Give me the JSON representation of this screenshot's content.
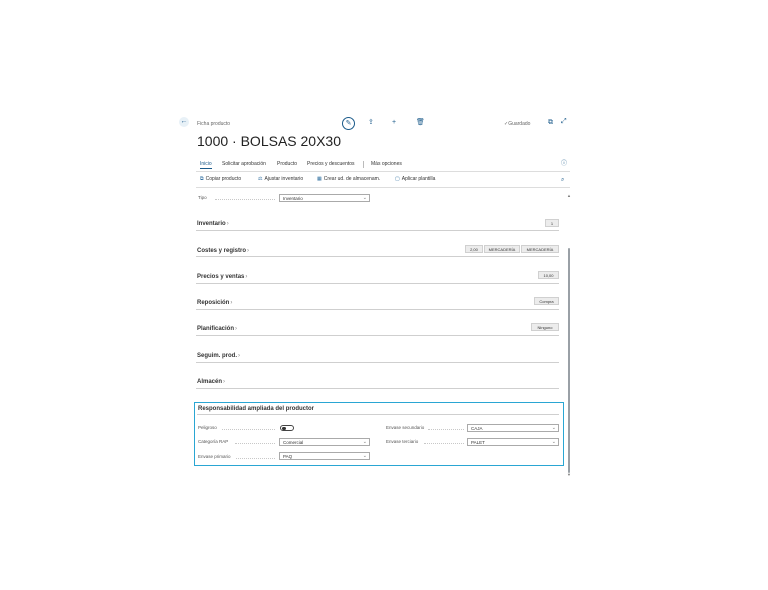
{
  "header": {
    "caption": "Ficha producto",
    "title": "1000 · BOLSAS 20X30",
    "saved_label": "✓Guardado"
  },
  "tabs": [
    {
      "label": "Inicio",
      "active": true
    },
    {
      "label": "Solicitar aprobación"
    },
    {
      "label": "Producto"
    },
    {
      "label": "Precios y descuentos"
    },
    {
      "label": "Más opciones"
    }
  ],
  "actions": [
    {
      "label": "Copiar producto"
    },
    {
      "label": "Ajustar inventario"
    },
    {
      "label": "Crear ud. de almacenam."
    },
    {
      "label": "Aplicar plantilla"
    }
  ],
  "tipo": {
    "label": "Tipo",
    "value": "Inventario"
  },
  "sections": [
    {
      "title": "Inventario",
      "chips": [
        "1"
      ]
    },
    {
      "title": "Costes y registro",
      "chips": [
        "2,00",
        "MERCADERÍA",
        "MERCADERÍA"
      ]
    },
    {
      "title": "Precios y ventas",
      "chips": [
        "10,00"
      ]
    },
    {
      "title": "Reposición",
      "chips": [
        "Compra"
      ]
    },
    {
      "title": "Planificación",
      "chips": [
        "Ninguno"
      ]
    },
    {
      "title": "Seguim. prod.",
      "chips": []
    },
    {
      "title": "Almacén",
      "chips": []
    }
  ],
  "epr": {
    "title": "Responsabilidad ampliada del productor",
    "peligroso": {
      "label": "Peligroso",
      "value": false
    },
    "categoria": {
      "label": "Categoría RAP",
      "value": "Comercial"
    },
    "primario": {
      "label": "Envase primario",
      "value": "PAQ"
    },
    "secundario": {
      "label": "Envase secundario",
      "value": "CAJA"
    },
    "terciario": {
      "label": "Envase terciario",
      "value": "PALET"
    }
  },
  "colors": {
    "accent": "#1a5a8a",
    "highlight": "#2aa6d3"
  }
}
